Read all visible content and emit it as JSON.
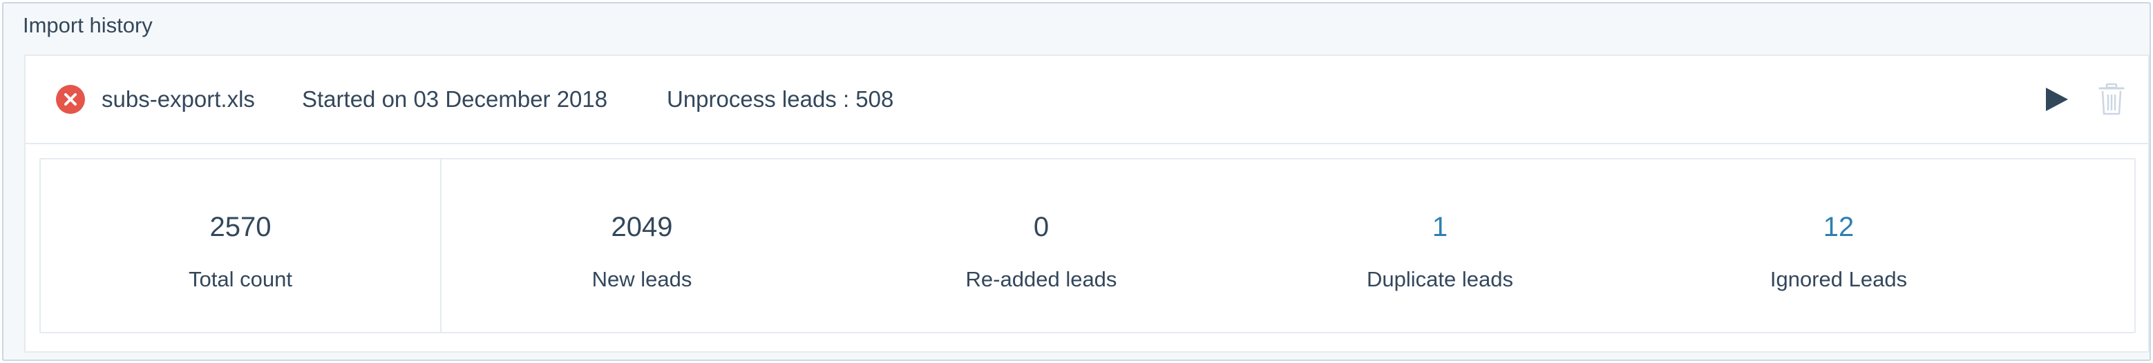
{
  "panel": {
    "title": "Import history"
  },
  "import": {
    "status_icon": "error-x-circle-icon",
    "status_color": "#e5554a",
    "file_name": "subs-export.xls",
    "started_on": "Started on 03 December 2018",
    "unprocess": "Unprocess leads : 508",
    "actions": {
      "play_icon": "play-icon",
      "delete_icon": "trash-icon"
    }
  },
  "stats": [
    {
      "value": "2570",
      "label": "Total count",
      "link": false
    },
    {
      "value": "2049",
      "label": "New leads",
      "link": false
    },
    {
      "value": "0",
      "label": "Re-added leads",
      "link": false
    },
    {
      "value": "1",
      "label": "Duplicate leads",
      "link": true
    },
    {
      "value": "12",
      "label": "Ignored Leads",
      "link": true
    }
  ],
  "colors": {
    "text": "#33475b",
    "link": "#2e7fb3",
    "error": "#e5554a",
    "border": "#e5ebf0",
    "panel_bg": "#f5f8fa"
  }
}
